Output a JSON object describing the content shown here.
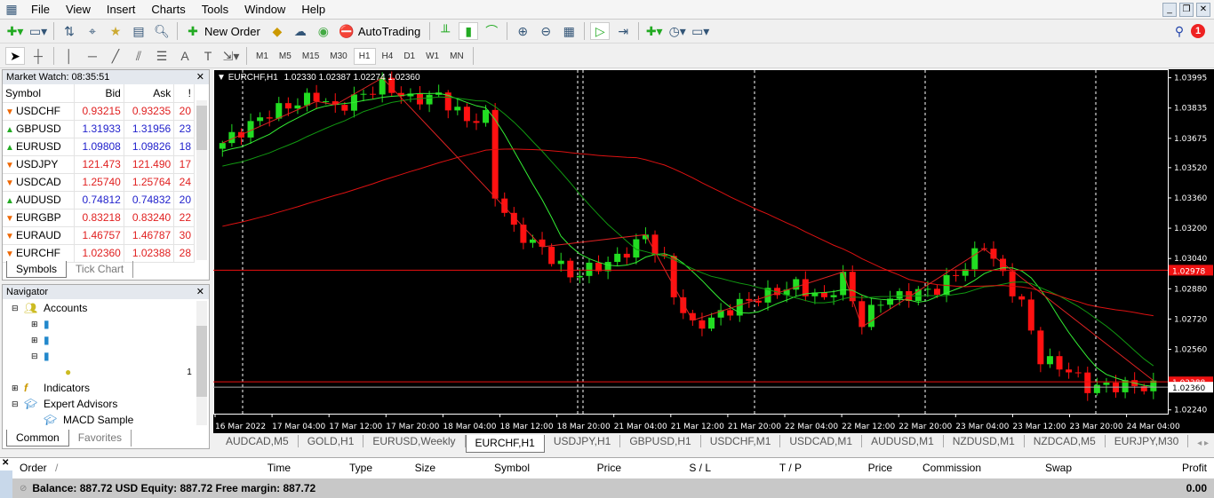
{
  "menu": [
    "File",
    "View",
    "Insert",
    "Charts",
    "Tools",
    "Window",
    "Help"
  ],
  "toolbar": {
    "new_order": "New Order",
    "autotrading": "AutoTrading",
    "notification_count": "1"
  },
  "timeframes": [
    "M1",
    "M5",
    "M15",
    "M30",
    "H1",
    "H4",
    "D1",
    "W1",
    "MN"
  ],
  "active_timeframe": "H1",
  "market_watch": {
    "title": "Market Watch: 08:35:51",
    "columns": [
      "Symbol",
      "Bid",
      "Ask",
      "!"
    ],
    "rows": [
      {
        "symbol": "USDCHF",
        "bid": "0.93215",
        "ask": "0.93235",
        "spread": "20",
        "dir": "down"
      },
      {
        "symbol": "GBPUSD",
        "bid": "1.31933",
        "ask": "1.31956",
        "spread": "23",
        "dir": "up"
      },
      {
        "symbol": "EURUSD",
        "bid": "1.09808",
        "ask": "1.09826",
        "spread": "18",
        "dir": "up"
      },
      {
        "symbol": "USDJPY",
        "bid": "121.473",
        "ask": "121.490",
        "spread": "17",
        "dir": "down"
      },
      {
        "symbol": "USDCAD",
        "bid": "1.25740",
        "ask": "1.25764",
        "spread": "24",
        "dir": "down"
      },
      {
        "symbol": "AUDUSD",
        "bid": "0.74812",
        "ask": "0.74832",
        "spread": "20",
        "dir": "up"
      },
      {
        "symbol": "EURGBP",
        "bid": "0.83218",
        "ask": "0.83240",
        "spread": "22",
        "dir": "down"
      },
      {
        "symbol": "EURAUD",
        "bid": "1.46757",
        "ask": "1.46787",
        "spread": "30",
        "dir": "down"
      },
      {
        "symbol": "EURCHF",
        "bid": "1.02360",
        "ask": "1.02388",
        "spread": "28",
        "dir": "down"
      }
    ],
    "tabs": [
      "Symbols",
      "Tick Chart"
    ]
  },
  "navigator": {
    "title": "Navigator",
    "items": {
      "accounts": "Accounts",
      "indicators": "Indicators",
      "experts": "Expert Advisors",
      "macd": "MACD Sample",
      "stray": "1"
    },
    "tabs": [
      "Common",
      "Favorites"
    ]
  },
  "chart_tabs": [
    "AUDCAD,M5",
    "GOLD,H1",
    "EURUSD,Weekly",
    "EURCHF,H1",
    "USDJPY,H1",
    "GBPUSD,H1",
    "USDCHF,M1",
    "USDCAD,M1",
    "AUDUSD,M1",
    "NZDUSD,M1",
    "NZDCAD,M5",
    "EURJPY,M30"
  ],
  "active_chart_tab": "EURCHF,H1",
  "terminal": {
    "columns": [
      "Order",
      "Time",
      "Type",
      "Size",
      "Symbol",
      "Price",
      "S / L",
      "T / P",
      "Price",
      "Commission",
      "Swap",
      "Profit"
    ],
    "sort_mark": "/",
    "balance_line": "Balance: 887.72 USD  Equity: 887.72  Free margin: 887.72",
    "profit": "0.00"
  },
  "colors": {
    "bull": "#22dd22",
    "bear": "#ff1111",
    "ma_fast": "#33ee33",
    "ma_mid": "#119911",
    "ma_slow": "#dd1111",
    "zigzag": "#dd2222"
  },
  "chart_data": {
    "type": "candlestick",
    "title": "EURCHF,H1",
    "ohlc_label": "1.02330 1.02387 1.02274 1.02360",
    "ylim": [
      1.0222,
      1.0404
    ],
    "y_ticks": [
      "1.03995",
      "1.03835",
      "1.03675",
      "1.03520",
      "1.03360",
      "1.03200",
      "1.03040",
      "1.02880",
      "1.02720",
      "1.02560",
      "1.02240"
    ],
    "x_ticks": [
      "16 Mar 2022",
      "17 Mar 04:00",
      "17 Mar 12:00",
      "17 Mar 20:00",
      "18 Mar 04:00",
      "18 Mar 12:00",
      "18 Mar 20:00",
      "21 Mar 04:00",
      "21 Mar 12:00",
      "21 Mar 20:00",
      "22 Mar 04:00",
      "22 Mar 12:00",
      "22 Mar 20:00",
      "23 Mar 04:00",
      "23 Mar 12:00",
      "23 Mar 20:00",
      "24 Mar 04:00"
    ],
    "bar_count": 100,
    "close_keypoints": [
      [
        0,
        1.0365
      ],
      [
        5,
        1.0381
      ],
      [
        10,
        1.039
      ],
      [
        12,
        1.0383
      ],
      [
        17,
        1.0396
      ],
      [
        20,
        1.0388
      ],
      [
        23,
        1.039
      ],
      [
        26,
        1.0377
      ],
      [
        28,
        1.0379
      ],
      [
        29,
        1.0338
      ],
      [
        31,
        1.0319
      ],
      [
        34,
        1.0309
      ],
      [
        37,
        1.0295
      ],
      [
        40,
        1.03
      ],
      [
        42,
        1.0304
      ],
      [
        45,
        1.0316
      ],
      [
        47,
        1.0302
      ],
      [
        48,
        1.0285
      ],
      [
        50,
        1.0268
      ],
      [
        52,
        1.0272
      ],
      [
        55,
        1.028
      ],
      [
        58,
        1.0285
      ],
      [
        61,
        1.029
      ],
      [
        64,
        1.0282
      ],
      [
        66,
        1.0294
      ],
      [
        68,
        1.027
      ],
      [
        70,
        1.0282
      ],
      [
        73,
        1.0285
      ],
      [
        76,
        1.0288
      ],
      [
        79,
        1.03
      ],
      [
        81,
        1.0312
      ],
      [
        83,
        1.0295
      ],
      [
        85,
        1.028
      ],
      [
        87,
        1.0251
      ],
      [
        90,
        1.0245
      ],
      [
        92,
        1.0236
      ],
      [
        96,
        1.0237
      ],
      [
        99,
        1.0236
      ]
    ],
    "hlines": [
      {
        "price": 1.02978,
        "label": "1.02978",
        "color": "#ee1111"
      },
      {
        "price": 1.02388,
        "label": "1.02388",
        "color": "#ee1111"
      },
      {
        "price": 1.0236,
        "label": "1.02360",
        "color": "#aaaaaa"
      }
    ]
  }
}
